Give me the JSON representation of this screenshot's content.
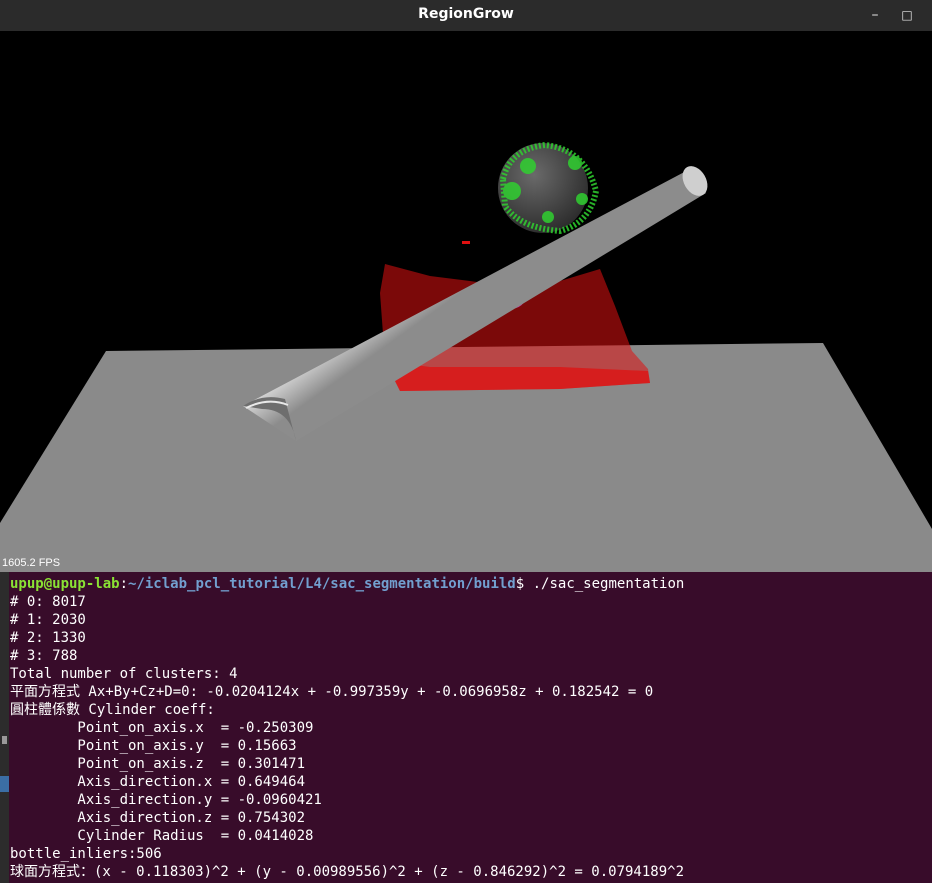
{
  "window": {
    "title": "RegionGrow",
    "minimize_glyph": "–",
    "maximize_glyph": "□"
  },
  "viewer": {
    "fps_label": "1605.2 FPS",
    "colors": {
      "background": "#000000",
      "plane": "#8a8a8a",
      "cylinder": "#b5b5b5",
      "sphere_cluster": "#30d030",
      "plane_cluster": "#e01010",
      "inner_cluster": "#d050d0"
    }
  },
  "terminal": {
    "prompt": {
      "user": "upup@upup-lab",
      "sep": ":",
      "path": "~/iclab_pcl_tutorial/L4/sac_segmentation/build",
      "symbol": "$ ",
      "command": "./sac_segmentation"
    },
    "lines": [
      "# 0: 8017",
      "# 1: 2030",
      "# 2: 1330",
      "# 3: 788",
      "Total number of clusters: 4",
      "平面方程式 Ax+By+Cz+D=0: -0.0204124x + -0.997359y + -0.0696958z + 0.182542 = 0",
      "圓柱體係數 Cylinder coeff:",
      "        Point_on_axis.x  = -0.250309",
      "        Point_on_axis.y  = 0.15663",
      "        Point_on_axis.z  = 0.301471",
      "        Axis_direction.x = 0.649464",
      "        Axis_direction.y = -0.0960421",
      "        Axis_direction.z = 0.754302",
      "        Cylinder Radius  = 0.0414028",
      "bottle_inliers:506",
      "球面方程式：(x - 0.118303)^2 + (y - 0.00989556)^2 + (z - 0.846292)^2 = 0.0794189^2"
    ]
  }
}
